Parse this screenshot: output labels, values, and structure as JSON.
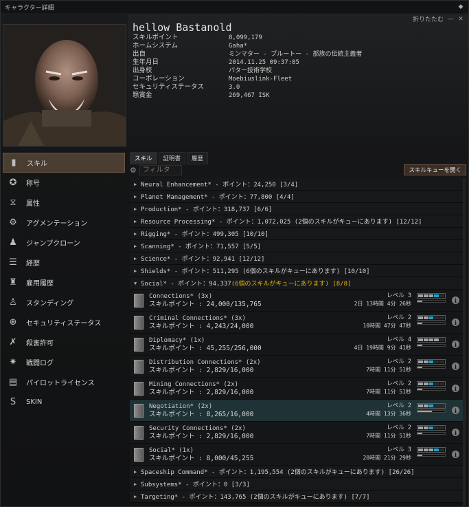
{
  "window": {
    "title": "キャラクター詳細",
    "collapse_label": "折りたたむ"
  },
  "character": {
    "name": "hellow Bastanold"
  },
  "info": [
    {
      "k": "スキルポイント",
      "v": "8,099,179"
    },
    {
      "k": "ホームシステム",
      "v": "Gaha*"
    },
    {
      "k": "出自",
      "v": "ミンマター - ブルートー - 部族の伝統主義者"
    },
    {
      "k": "生年月日",
      "v": "2014.11.25 09:37:05"
    },
    {
      "k": "出身校",
      "v": "パター技術学校"
    },
    {
      "k": "コーポレーション",
      "v": "Moebiuslink-Fleet"
    },
    {
      "k": "セキュリティステータス",
      "v": "3.0"
    },
    {
      "k": "懸賞金",
      "v": "269,467 ISK"
    }
  ],
  "nav": [
    {
      "label": "スキル",
      "icon": "skills-book-icon",
      "glyph": "▮",
      "active": true
    },
    {
      "label": "称号",
      "icon": "decorations-icon",
      "glyph": "✪"
    },
    {
      "label": "属性",
      "icon": "attributes-icon",
      "glyph": "⧖"
    },
    {
      "label": "アグメンテーション",
      "icon": "augmentations-icon",
      "glyph": "⚙"
    },
    {
      "label": "ジャンプクローン",
      "icon": "jump-clone-icon",
      "glyph": "♟"
    },
    {
      "label": "経歴",
      "icon": "bio-icon",
      "glyph": "☰"
    },
    {
      "label": "雇用履歴",
      "icon": "employment-history-icon",
      "glyph": "♜"
    },
    {
      "label": "スタンディング",
      "icon": "standings-icon",
      "glyph": "♙"
    },
    {
      "label": "セキュリティステータス",
      "icon": "security-status-icon",
      "glyph": "⊕"
    },
    {
      "label": "殺害許可",
      "icon": "kill-rights-icon",
      "glyph": "✗"
    },
    {
      "label": "戦闘ログ",
      "icon": "combat-log-icon",
      "glyph": "✷"
    },
    {
      "label": "パイロットライセンス",
      "icon": "pilot-license-icon",
      "glyph": "▤"
    },
    {
      "label": "SKIN",
      "icon": "skin-icon",
      "glyph": "S"
    }
  ],
  "tabs": [
    "スキル",
    "証明書",
    "履歴"
  ],
  "filter": {
    "placeholder": "フィルタ"
  },
  "queue_button": "スキルキューを開く",
  "groups_before": [
    {
      "text": "Neural Enhancement* - ポイント：24,250 [3/4]"
    },
    {
      "text": "Planet Management* - ポイント：77,800 [4/4]"
    },
    {
      "text": "Production* - ポイント：318,737 [6/6]"
    },
    {
      "text": "Resource Processing* - ポイント：1,072,025 (2個のスキルがキューにあります) [12/12]"
    },
    {
      "text": "Rigging* - ポイント：499,305 [10/10]"
    },
    {
      "text": "Scanning* - ポイント：71,557 [5/5]"
    },
    {
      "text": "Science* - ポイント：92,941 [12/12]"
    },
    {
      "text": "Shields* - ポイント：511,295 (6個のスキルがキューにあります) [10/10]"
    }
  ],
  "expanded_group": {
    "text": "Social* - ポイント：94,337",
    "highlight": "(6個のスキルがキューにあります) [8/8]"
  },
  "skills": [
    {
      "name": "Connections* (3x)",
      "sp": "スキルポイント : 24,000/135,765",
      "level": "レベル 3",
      "time": "2日 13時間 4分 26秒",
      "trained": 3,
      "queued": 1,
      "progress": 0.18
    },
    {
      "name": "Criminal Connections* (3x)",
      "sp": "スキルポイント : 4,243/24,000",
      "level": "レベル 2",
      "time": "10時間 47分 47秒",
      "trained": 2,
      "queued": 1,
      "progress": 0.18
    },
    {
      "name": "Diplomacy* (1x)",
      "sp": "スキルポイント : 45,255/256,000",
      "level": "レベル 4",
      "time": "4日 19時間 9分 41秒",
      "trained": 4,
      "queued": 0,
      "progress": 0.18
    },
    {
      "name": "Distribution Connections* (2x)",
      "sp": "スキルポイント : 2,829/16,000",
      "level": "レベル 2",
      "time": "7時間 11分 51秒",
      "trained": 2,
      "queued": 1,
      "progress": 0.18
    },
    {
      "name": "Mining Connections* (2x)",
      "sp": "スキルポイント : 2,829/16,000",
      "level": "レベル 2",
      "time": "7時間 11分 51秒",
      "trained": 2,
      "queued": 1,
      "progress": 0.18
    },
    {
      "name": "Negotiation* (2x)",
      "sp": "スキルポイント : 8,265/16,000",
      "level": "レベル 2",
      "time": "4時間 13分 36秒",
      "trained": 2,
      "queued": 1,
      "progress": 0.52,
      "selected": true
    },
    {
      "name": "Security Connections* (2x)",
      "sp": "スキルポイント : 2,829/16,000",
      "level": "レベル 2",
      "time": "7時間 11分 51秒",
      "trained": 2,
      "queued": 1,
      "progress": 0.18
    },
    {
      "name": "Social* (1x)",
      "sp": "スキルポイント : 8,000/45,255",
      "level": "レベル 3",
      "time": "20時間 21分 29秒",
      "trained": 3,
      "queued": 1,
      "progress": 0.18
    }
  ],
  "groups_after": [
    {
      "text": "Spaceship Command* - ポイント：1,195,554 (2個のスキルがキューにあります) [26/26]"
    },
    {
      "text": "Subsystems* - ポイント：0 [3/3]"
    },
    {
      "text": "Targeting* - ポイント：143,765 (2個のスキルがキューにあります) [7/7]"
    }
  ]
}
